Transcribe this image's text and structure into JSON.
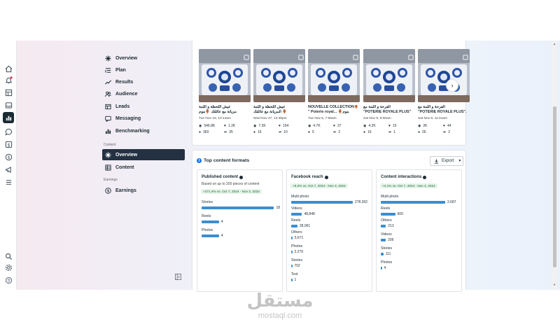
{
  "rail_icons": [
    "home-icon",
    "bell-icon",
    "table-icon",
    "inbox-icon",
    "insights-icon",
    "chat-icon",
    "dollar-icon",
    "dollar-circle-icon",
    "megaphone-icon",
    "menu-icon",
    "search-icon",
    "settings-icon",
    "help-icon"
  ],
  "nav": {
    "items": [
      {
        "label": "Overview",
        "icon": "overview-icon"
      },
      {
        "label": "Plan",
        "icon": "plan-icon"
      },
      {
        "label": "Results",
        "icon": "results-icon"
      },
      {
        "label": "Audience",
        "icon": "audience-icon"
      },
      {
        "label": "Leads",
        "icon": "leads-icon"
      },
      {
        "label": "Messaging",
        "icon": "messaging-icon"
      },
      {
        "label": "Benchmarking",
        "icon": "benchmarking-icon"
      }
    ],
    "content_section": "Content",
    "content_items": [
      {
        "label": "Overview",
        "icon": "overview-icon",
        "active": true
      },
      {
        "label": "Content",
        "icon": "content-icon"
      }
    ],
    "earnings_section": "Earnings",
    "earnings_items": [
      {
        "label": "Earnings",
        "icon": "earnings-icon"
      }
    ]
  },
  "posts": [
    {
      "title": "عيش اللحظة و اللمة\nمزيانة مع عائلتك 🏺بنوم",
      "date": "Tue Nov 19, 10:14am",
      "reach": "546.8K",
      "likes": "1.2K",
      "comments": "360",
      "shares": "35"
    },
    {
      "title": "عيش اللحظة و اللمة\nالمزيانة مع عائلتك 🏺",
      "date": "Wed Nov 27, 12:48pm",
      "reach": "7.3K",
      "likes": "154",
      "comments": "16",
      "shares": "10"
    },
    {
      "title": "NOUVELLE COLLECTION🏺\n\" Poterie royal... 🏺بنوم",
      "date": "Tue Nov 5, 7:56am",
      "reach": "4.7K",
      "likes": "37",
      "comments": "5",
      "shares": "2"
    },
    {
      "title": "الفرحة و اللمة مع\n\"POTERIE ROYALE PLUS\"",
      "date": "Sat Nov 9, 9:00am",
      "reach": "4.2K",
      "likes": "15",
      "comments": "16",
      "shares": "1"
    },
    {
      "title": "الفرحة و اللمة مع\n\"POTERIE ROYALE PLUS\".",
      "date": "Sat Nov 9, 11:01am",
      "reach": "2K",
      "likes": "44",
      "comments": "26",
      "shares": "2"
    }
  ],
  "formats": {
    "title": "Top content formats",
    "export_label": "Export",
    "cards": [
      {
        "title": "Published content",
        "subtitle": "Based on up to 200 pieces of content",
        "change": "+271.4% vs. Oct 7, 2024 - Nov 3, 2024",
        "rows": [
          {
            "label": "Stories",
            "value": "18",
            "ratio": 1.0
          },
          {
            "label": "Reels",
            "value": "4",
            "ratio": 0.222
          },
          {
            "label": "Photos",
            "value": "4",
            "ratio": 0.222
          }
        ]
      },
      {
        "title": "Facebook reach",
        "subtitle": "",
        "change": "+9.2% vs. Oct 7, 2024 - Nov 3, 2024",
        "rows": [
          {
            "label": "Multi photo",
            "value": "278,002",
            "ratio": 1.0
          },
          {
            "label": "Videos",
            "value": "48,848",
            "ratio": 0.176
          },
          {
            "label": "Reels",
            "value": "28,061",
            "ratio": 0.101
          },
          {
            "label": "Others",
            "value": "5,671",
            "ratio": 0.02
          },
          {
            "label": "Photos",
            "value": "2,279",
            "ratio": 0.008
          },
          {
            "label": "Stories",
            "value": "702",
            "ratio": 0.003
          },
          {
            "label": "Text",
            "value": "1",
            "ratio": 0.0
          }
        ]
      },
      {
        "title": "Content interactions",
        "subtitle": "",
        "change": "+2.1% vs. Oct 7, 2024 - Nov 3, 2024",
        "rows": [
          {
            "label": "Multi photo",
            "value": "2,687",
            "ratio": 1.0
          },
          {
            "label": "Reels",
            "value": "600",
            "ratio": 0.223
          },
          {
            "label": "Others",
            "value": "213",
            "ratio": 0.079
          },
          {
            "label": "Videos",
            "value": "206",
            "ratio": 0.077
          },
          {
            "label": "Stories",
            "value": "111",
            "ratio": 0.041
          },
          {
            "label": "Photos",
            "value": "4",
            "ratio": 0.0015
          }
        ]
      }
    ]
  },
  "watermark": {
    "arabic": "مستقل",
    "latin": "mostaql.com"
  },
  "colors": {
    "accent": "#3b8ed0",
    "active_nav": "#233142",
    "badge_bg": "#e6f4ea",
    "badge_text": "#18652f"
  }
}
